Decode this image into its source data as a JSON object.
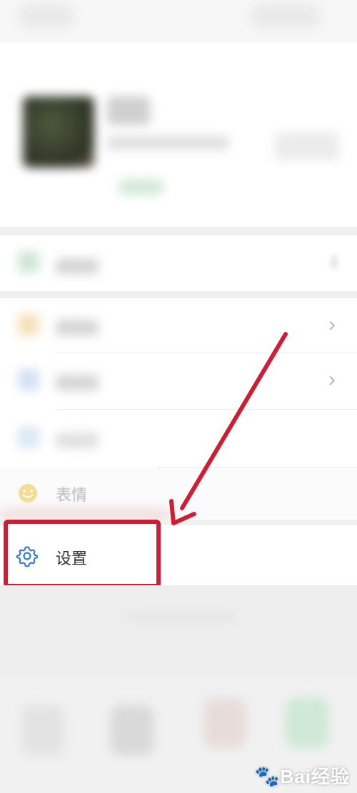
{
  "menu": {
    "emoji_label": "表情",
    "settings_label": "设置"
  },
  "icons": {
    "settings": "gear-icon",
    "emoji": "smiley-icon",
    "chevron": "chevron-right-icon"
  },
  "annotation": {
    "highlight_color": "#cc1f35",
    "arrow_color": "#cc1f35"
  },
  "watermark": {
    "text": "Bai经验"
  }
}
